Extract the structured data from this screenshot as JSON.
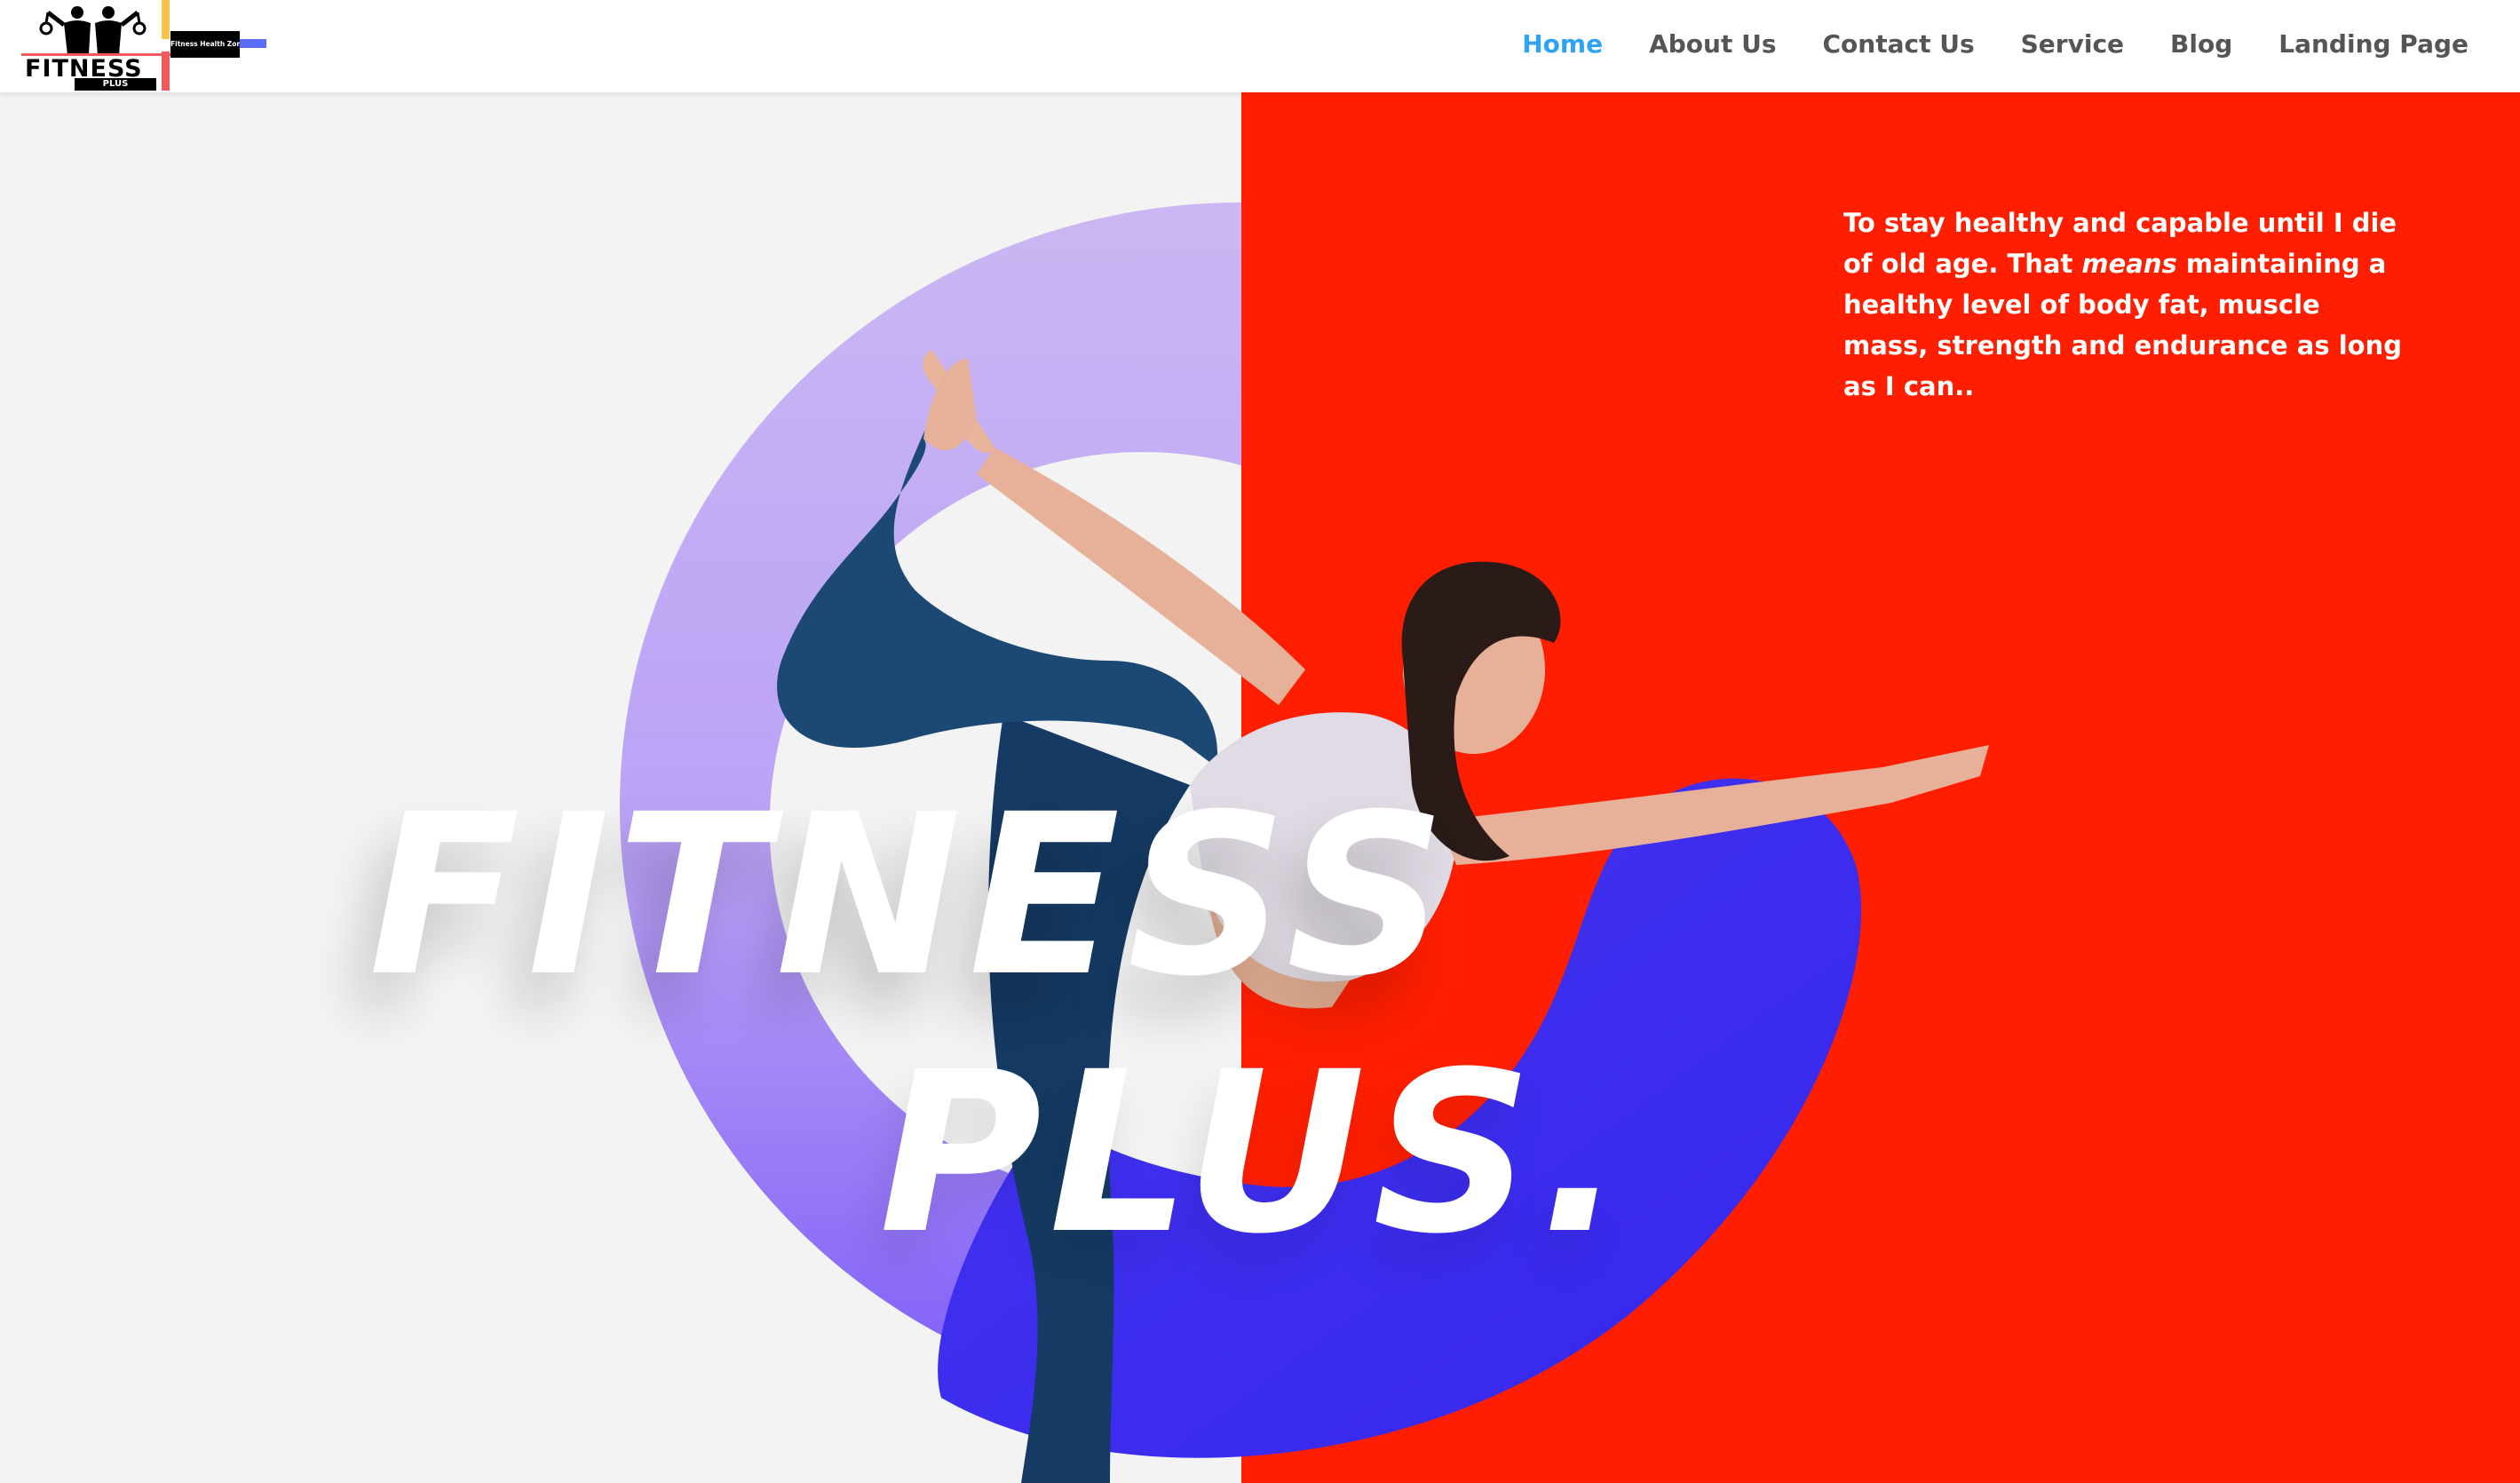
{
  "brand": {
    "logo_word": "FITNESS",
    "logo_sub": "PLUS",
    "logo_tagline": "Fitness Health Zone"
  },
  "nav": {
    "items": [
      {
        "label": "Home",
        "active": true
      },
      {
        "label": "About Us",
        "active": false
      },
      {
        "label": "Contact Us",
        "active": false
      },
      {
        "label": "Service",
        "active": false
      },
      {
        "label": "Blog",
        "active": false
      },
      {
        "label": "Landing Page",
        "active": false
      }
    ]
  },
  "hero": {
    "quote_part1": "To stay healthy and capable until I die of old age. That ",
    "quote_emphasis": "means",
    "quote_part2": " maintaining a healthy level of body fat, muscle mass, strength and endurance as long as I can..",
    "title_line1": "FITNESS",
    "title_line2": "PLUS."
  },
  "colors": {
    "accent_nav": "#2ea3f2",
    "hero_red": "#ff1f00",
    "hero_grey": "#f3f3f3",
    "ring_lavender": "#c9b6f2",
    "ring_blue": "#3a2fef"
  }
}
